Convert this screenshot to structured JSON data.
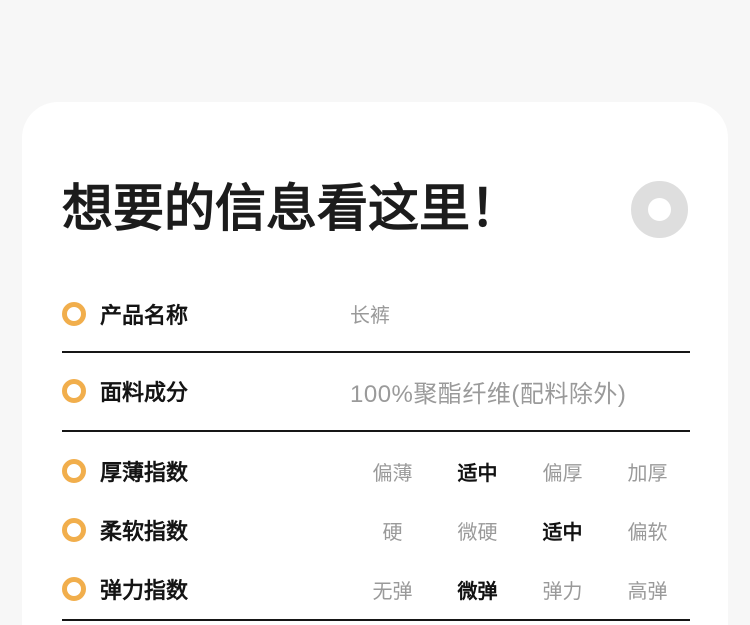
{
  "colors": {
    "page_background": "#f7f7f7",
    "card_background": "#ffffff",
    "accent_ring": "#f1ae4c",
    "decor_ring": "#dedede",
    "muted_text": "#9a9a9a",
    "dark_text": "#141414",
    "divider": "#161616"
  },
  "header": {
    "title": "想要的信息看这里！",
    "decor_icon": "ring-icon"
  },
  "info_rows": [
    {
      "icon": "ring-bullet-icon",
      "label": "产品名称",
      "value": "长裤"
    },
    {
      "icon": "ring-bullet-icon",
      "label": "面料成分",
      "value": "100%聚酯纤维(配料除外)"
    }
  ],
  "index_rows": [
    {
      "icon": "ring-bullet-icon",
      "label": "厚薄指数",
      "options": [
        "偏薄",
        "适中",
        "偏厚",
        "加厚"
      ],
      "selected_index": 1,
      "selected_label": "适中"
    },
    {
      "icon": "ring-bullet-icon",
      "label": "柔软指数",
      "options": [
        "硬",
        "微硬",
        "适中",
        "偏软"
      ],
      "selected_index": 2,
      "selected_label": "适中"
    },
    {
      "icon": "ring-bullet-icon",
      "label": "弹力指数",
      "options": [
        "无弹",
        "微弹",
        "弹力",
        "高弹"
      ],
      "selected_index": 1,
      "selected_label": "微弹"
    }
  ]
}
